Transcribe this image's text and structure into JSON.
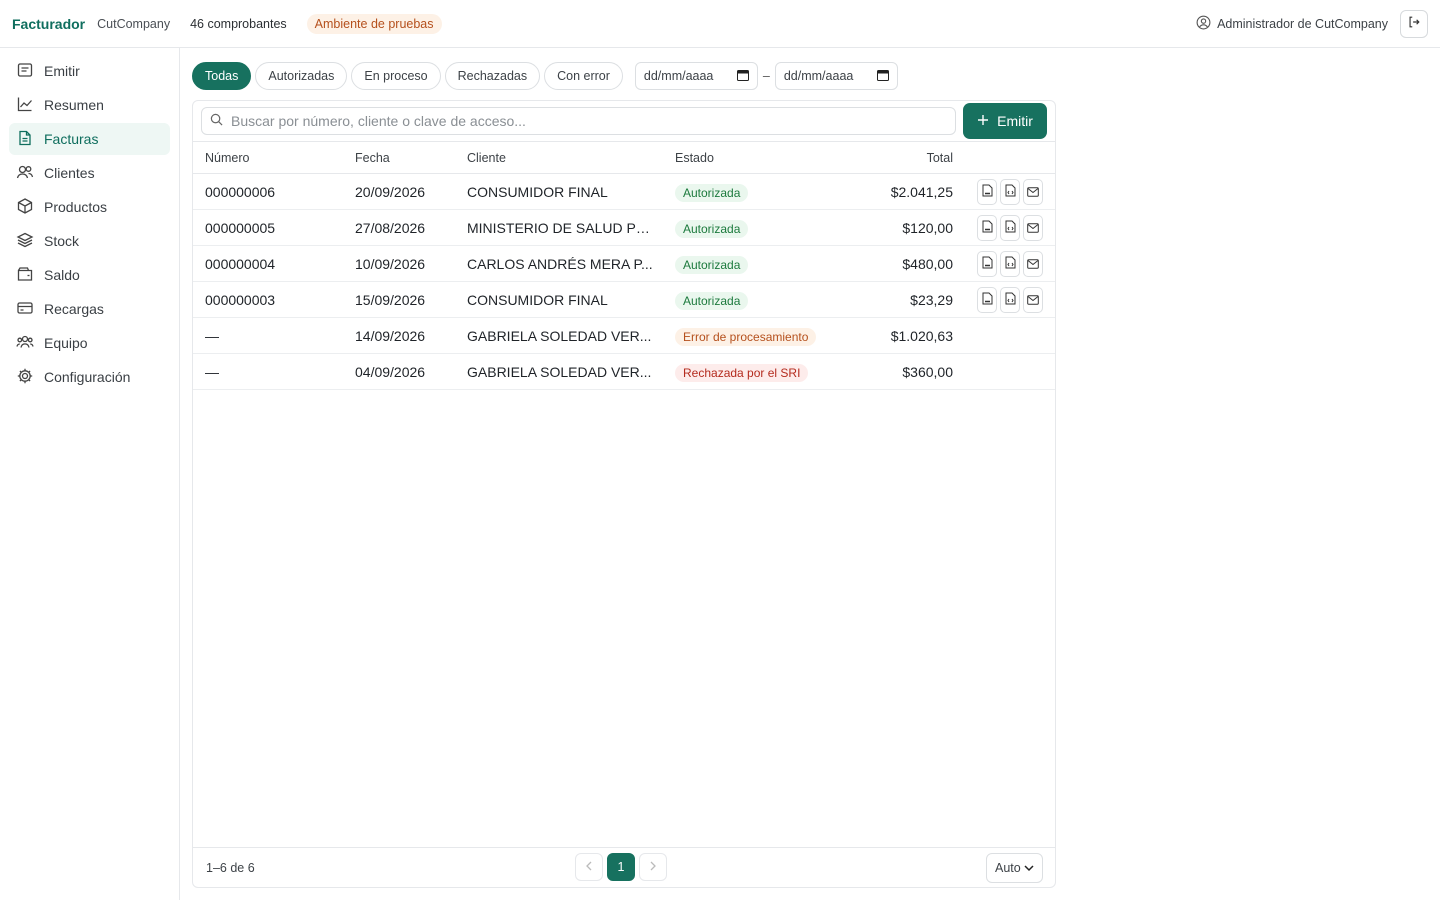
{
  "header": {
    "brand": "Facturador",
    "company": "CutCompany",
    "count": "46 comprobantes",
    "environment": "Ambiente de pruebas",
    "user": "Administrador de CutCompany",
    "icons": {
      "user": "user-circle-icon",
      "logout": "logout-icon"
    }
  },
  "sidebar": {
    "items": [
      {
        "label": "Emitir",
        "icon": "receipt-icon",
        "active": false
      },
      {
        "label": "Resumen",
        "icon": "chart-line-icon",
        "active": false
      },
      {
        "label": "Facturas",
        "icon": "document-icon",
        "active": true
      },
      {
        "label": "Clientes",
        "icon": "users-icon",
        "active": false
      },
      {
        "label": "Productos",
        "icon": "box-icon",
        "active": false
      },
      {
        "label": "Stock",
        "icon": "layers-icon",
        "active": false
      },
      {
        "label": "Saldo",
        "icon": "wallet-icon",
        "active": false
      },
      {
        "label": "Recargas",
        "icon": "credit-card-icon",
        "active": false
      },
      {
        "label": "Equipo",
        "icon": "team-icon",
        "active": false
      },
      {
        "label": "Configuración",
        "icon": "gear-icon",
        "active": false
      }
    ]
  },
  "filters": {
    "chips": [
      "Todas",
      "Autorizadas",
      "En proceso",
      "Rechazadas",
      "Con error"
    ],
    "active_chip": "Todas",
    "date_from_placeholder": "dd/mm/aaaa",
    "date_to_placeholder": "dd/mm/aaaa",
    "date_separator": "–"
  },
  "toolbar": {
    "search_placeholder": "Buscar por número, cliente o clave de acceso...",
    "emit_label": "Emitir"
  },
  "table": {
    "columns": {
      "numero": "Número",
      "fecha": "Fecha",
      "cliente": "Cliente",
      "estado": "Estado",
      "total": "Total"
    },
    "rows": [
      {
        "numero": "000000006",
        "fecha": "20/09/2026",
        "cliente": "CONSUMIDOR FINAL",
        "estado": "Autorizada",
        "total": "$2.041,25"
      },
      {
        "numero": "000000005",
        "fecha": "27/08/2026",
        "cliente": "MINISTERIO DE SALUD PÚ...",
        "estado": "Autorizada",
        "total": "$120,00"
      },
      {
        "numero": "000000004",
        "fecha": "10/09/2026",
        "cliente": "CARLOS ANDRÉS MERA P...",
        "estado": "Autorizada",
        "total": "$480,00"
      },
      {
        "numero": "000000003",
        "fecha": "15/09/2026",
        "cliente": "CONSUMIDOR FINAL",
        "estado": "Autorizada",
        "total": "$23,29"
      },
      {
        "numero": "—",
        "fecha": "14/09/2026",
        "cliente": "GABRIELA SOLEDAD VER...",
        "estado": "Error de procesamiento",
        "total": "$1.020,63"
      },
      {
        "numero": "—",
        "fecha": "04/09/2026",
        "cliente": "GABRIELA SOLEDAD VER...",
        "estado": "Rechazada por el SRI",
        "total": "$360,00"
      }
    ]
  },
  "footer": {
    "range": "1–6 de 6",
    "current_page": "1",
    "page_size": "Auto"
  },
  "colors": {
    "accent": "#17715f",
    "brand": "#0f6e5e",
    "warning": "#b5501d",
    "danger": "#b42b1e",
    "success": "#1c7a3d"
  }
}
